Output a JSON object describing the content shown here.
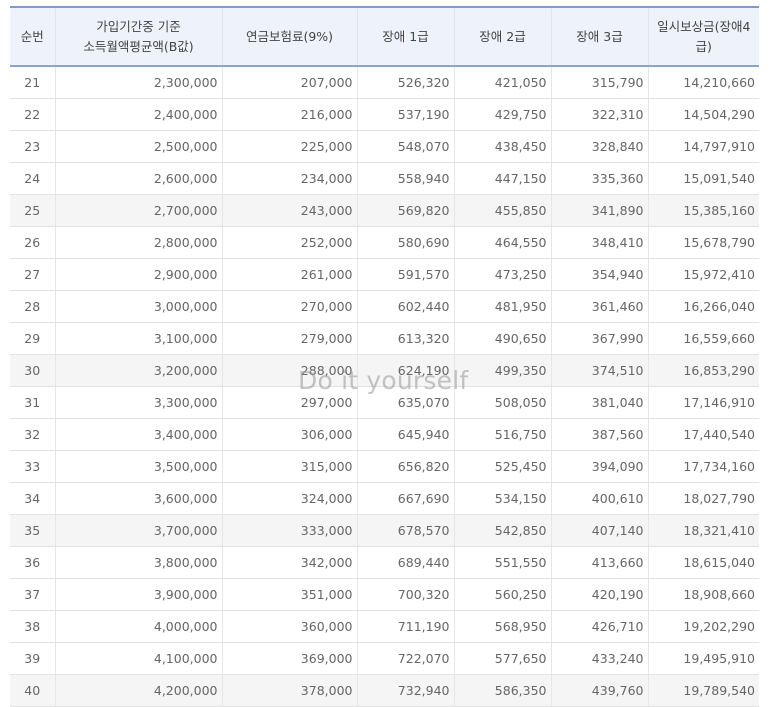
{
  "table": {
    "headers": [
      {
        "lines": [
          "순번"
        ]
      },
      {
        "lines": [
          "가입기간중 기준",
          "소득월액평균액(B값)"
        ]
      },
      {
        "lines": [
          "연금보험료(9%)"
        ]
      },
      {
        "lines": [
          "장애 1급"
        ]
      },
      {
        "lines": [
          "장애 2급"
        ]
      },
      {
        "lines": [
          "장애 3급"
        ]
      },
      {
        "lines": [
          "일시보상금(장애4급)"
        ]
      }
    ],
    "rows": [
      [
        "21",
        "2,300,000",
        "207,000",
        "526,320",
        "421,050",
        "315,790",
        "14,210,660"
      ],
      [
        "22",
        "2,400,000",
        "216,000",
        "537,190",
        "429,750",
        "322,310",
        "14,504,290"
      ],
      [
        "23",
        "2,500,000",
        "225,000",
        "548,070",
        "438,450",
        "328,840",
        "14,797,910"
      ],
      [
        "24",
        "2,600,000",
        "234,000",
        "558,940",
        "447,150",
        "335,360",
        "15,091,540"
      ],
      [
        "25",
        "2,700,000",
        "243,000",
        "569,820",
        "455,850",
        "341,890",
        "15,385,160"
      ],
      [
        "26",
        "2,800,000",
        "252,000",
        "580,690",
        "464,550",
        "348,410",
        "15,678,790"
      ],
      [
        "27",
        "2,900,000",
        "261,000",
        "591,570",
        "473,250",
        "354,940",
        "15,972,410"
      ],
      [
        "28",
        "3,000,000",
        "270,000",
        "602,440",
        "481,950",
        "361,460",
        "16,266,040"
      ],
      [
        "29",
        "3,100,000",
        "279,000",
        "613,320",
        "490,650",
        "367,990",
        "16,559,660"
      ],
      [
        "30",
        "3,200,000",
        "288,000",
        "624,190",
        "499,350",
        "374,510",
        "16,853,290"
      ],
      [
        "31",
        "3,300,000",
        "297,000",
        "635,070",
        "508,050",
        "381,040",
        "17,146,910"
      ],
      [
        "32",
        "3,400,000",
        "306,000",
        "645,940",
        "516,750",
        "387,560",
        "17,440,540"
      ],
      [
        "33",
        "3,500,000",
        "315,000",
        "656,820",
        "525,450",
        "394,090",
        "17,734,160"
      ],
      [
        "34",
        "3,600,000",
        "324,000",
        "667,690",
        "534,150",
        "400,610",
        "18,027,790"
      ],
      [
        "35",
        "3,700,000",
        "333,000",
        "678,570",
        "542,850",
        "407,140",
        "18,321,410"
      ],
      [
        "36",
        "3,800,000",
        "342,000",
        "689,440",
        "551,550",
        "413,660",
        "18,615,040"
      ],
      [
        "37",
        "3,900,000",
        "351,000",
        "700,320",
        "560,250",
        "420,190",
        "18,908,660"
      ],
      [
        "38",
        "4,000,000",
        "360,000",
        "711,190",
        "568,950",
        "426,710",
        "19,202,290"
      ],
      [
        "39",
        "4,100,000",
        "369,000",
        "722,070",
        "577,650",
        "433,240",
        "19,495,910"
      ],
      [
        "40",
        "4,200,000",
        "378,000",
        "732,940",
        "586,350",
        "439,760",
        "19,789,540"
      ]
    ],
    "shaded_rows": [
      25,
      30,
      35,
      40
    ]
  },
  "watermark": "Do it yourself",
  "colors": {
    "header_bg": "#eef3fb",
    "header_border": "#7f9ad3",
    "shaded_row_bg": "#f5f5f5"
  }
}
